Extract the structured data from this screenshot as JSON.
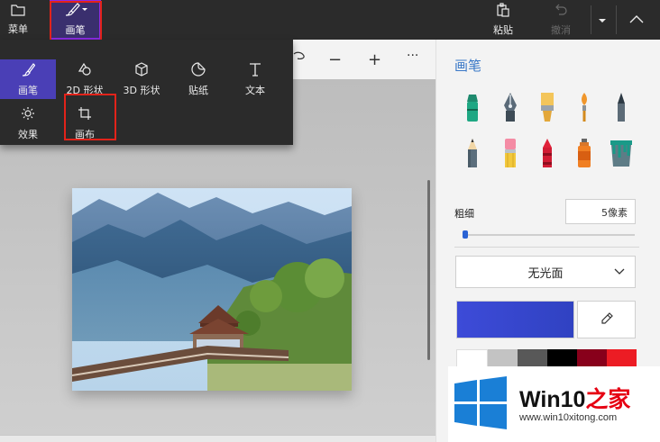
{
  "toolbar": {
    "menu_label": "菜单",
    "brushes_label": "画笔",
    "paste_label": "粘贴",
    "undo_label": "撤消",
    "menu_icon": "folder-icon",
    "brushes_icon": "brush-icon",
    "paste_icon": "clipboard-icon",
    "undo_icon": "undo-icon",
    "dropdown_icon": "caret-down-icon",
    "collapse_icon": "chevron-up-icon"
  },
  "tools_menu": {
    "items": [
      {
        "label": "画笔",
        "icon": "brush-icon",
        "active": true
      },
      {
        "label": "2D 形状",
        "icon": "shapes-2d-icon"
      },
      {
        "label": "3D 形状",
        "icon": "cube-icon"
      },
      {
        "label": "贴纸",
        "icon": "sticker-icon"
      },
      {
        "label": "文本",
        "icon": "text-icon"
      },
      {
        "label": "效果",
        "icon": "sun-icon"
      },
      {
        "label": "画布",
        "icon": "canvas-crop-icon",
        "highlighted": true
      }
    ]
  },
  "subbar": {
    "minus": "−",
    "plus": "+",
    "more": "···"
  },
  "panel": {
    "title": "画笔",
    "brushes": [
      "marker-brush",
      "calligraphy-pen",
      "oil-brush",
      "watercolor-brush",
      "pixel-pen",
      "pencil",
      "eraser",
      "crayon",
      "spray-can",
      "fill-bucket"
    ],
    "thickness_label": "粗细",
    "thickness_value": "5像素",
    "thickness_level": 0.02,
    "finish_label": "无光面",
    "current_color": "#3a47d0",
    "palette": [
      "#ffffff",
      "#c3c3c3",
      "#585858",
      "#000000",
      "#88001b",
      "#ec1c24"
    ]
  },
  "watermark": {
    "title_prefix": "Win10",
    "title_suffix": "之家",
    "url": "www.win10xitong.com"
  },
  "colors": {
    "accent": "#4a3fb6",
    "highlight": "#e2231a",
    "panel_title": "#3a78c7"
  }
}
